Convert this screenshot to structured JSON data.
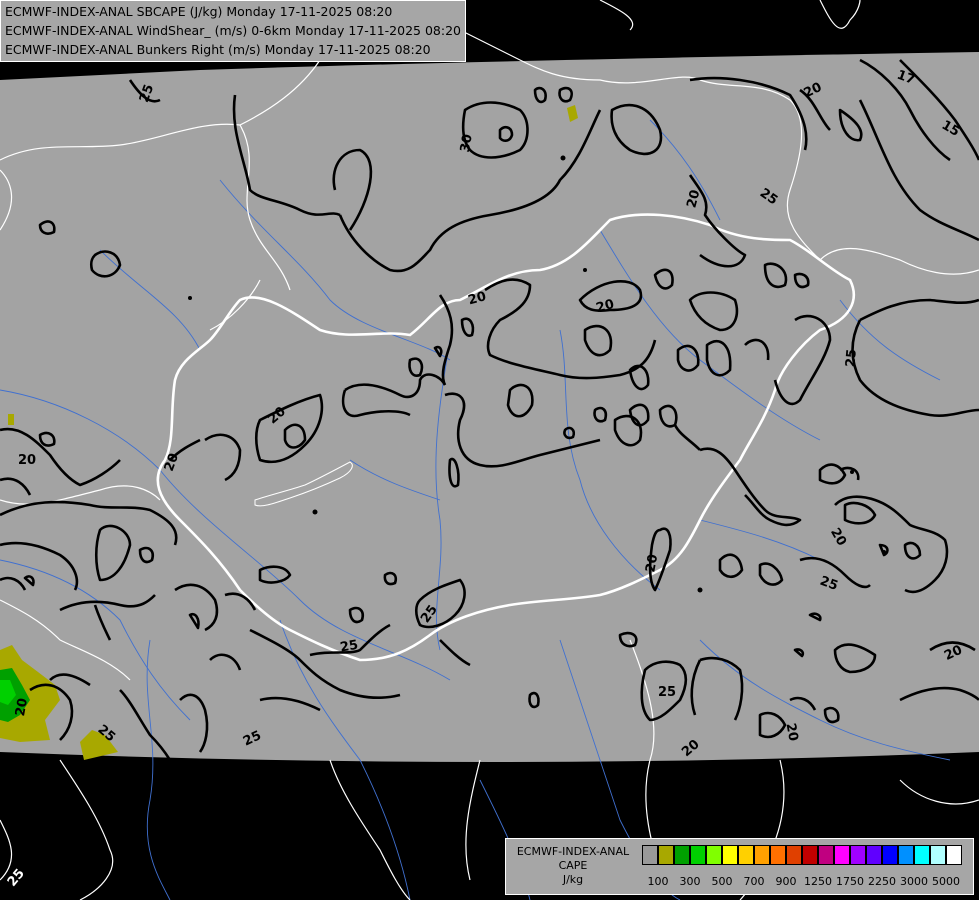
{
  "header": {
    "line1": "ECMWF-INDEX-ANAL SBCAPE (J/kg) Monday 17-11-2025 08:20",
    "line2": "ECMWF-INDEX-ANAL WindShear_ (m/s) 0-6km Monday 17-11-2025 08:20",
    "line3": "ECMWF-INDEX-ANAL Bunkers Right (m/s) Monday 17-11-2025 08:20"
  },
  "legend": {
    "title_line1": "ECMWF-INDEX-ANAL",
    "title_line2": "CAPE",
    "title_line3": "J/kg",
    "colors": [
      "#999999",
      "#a8a800",
      "#00a000",
      "#00d000",
      "#80ff00",
      "#ffff00",
      "#ffd000",
      "#ffa000",
      "#ff7000",
      "#e04000",
      "#c00000",
      "#c00080",
      "#ff00ff",
      "#a000ff",
      "#6000ff",
      "#0000ff",
      "#0090ff",
      "#00ffff",
      "#b0ffff",
      "#ffffff"
    ],
    "ticks": [
      "100",
      "300",
      "500",
      "700",
      "900",
      "1250",
      "1750",
      "2250",
      "3000",
      "5000"
    ]
  },
  "contour_labels": [
    "25",
    "30",
    "20",
    "17",
    "15",
    "20",
    "25",
    "20",
    "20",
    "20",
    "25",
    "20",
    "20",
    "20",
    "20",
    "25",
    "25",
    "20",
    "25",
    "25",
    "25",
    "25",
    "20",
    "20",
    "20",
    "25"
  ]
}
